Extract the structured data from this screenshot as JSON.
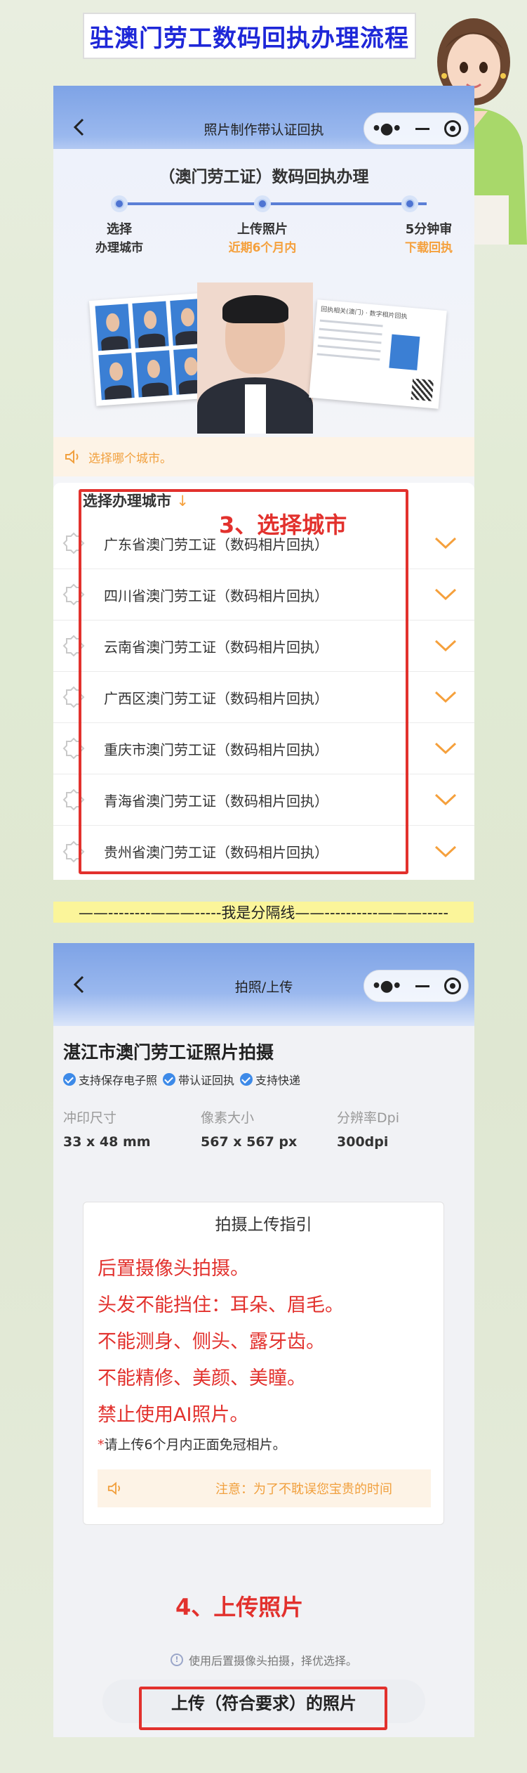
{
  "banner": {
    "title": "驻澳门劳工数码回执办理流程"
  },
  "phone1": {
    "nav_title": "照片制作带认证回执",
    "hero_title": "（澳门劳工证）数码回执办理",
    "steps": [
      {
        "label": "选择",
        "sub": "办理城市",
        "sub_color": "#333333"
      },
      {
        "label": "上传照片",
        "sub": "近期6个月内",
        "sub_color": "#f5a03c"
      },
      {
        "label": "5分钟审",
        "sub": "下载回执",
        "sub_color": "#f5a03c"
      }
    ],
    "receipt_header": "回执相关(澳门) · 数字相片回执",
    "notice": "选择哪个城市。",
    "city_header": "选择办理城市",
    "city_header_arrow": "↓",
    "cities": [
      "广东省澳门劳工证（数码相片回执）",
      "四川省澳门劳工证（数码相片回执）",
      "云南省澳门劳工证（数码相片回执）",
      "广西区澳门劳工证（数码相片回执）",
      "重庆市澳门劳工证（数码相片回执）",
      "青海省澳门劳工证（数码相片回执）",
      "贵州省澳门劳工证（数码相片回执）"
    ]
  },
  "annotations": {
    "step3": "3、选择城市",
    "step4": "4、上传照片"
  },
  "divider": {
    "text": "——--------———-----我是分隔线——----------———-----"
  },
  "phone2": {
    "nav_title": "拍照/上传",
    "title": "湛江市澳门劳工证照片拍摄",
    "tags": [
      "支持保存电子照",
      "带认证回执",
      "支持快递"
    ],
    "specs": [
      {
        "label": "冲印尺寸",
        "value": "33 x 48 mm"
      },
      {
        "label": "像素大小",
        "value": "567 x 567 px"
      },
      {
        "label": "分辨率Dpi",
        "value": "300dpi"
      }
    ],
    "guide_title": "拍摄上传指引",
    "guide_lines": [
      "后置摄像头拍摄。",
      "头发不能挡住：耳朵、眉毛。",
      "不能测身、侧头、露牙齿。",
      "不能精修、美颜、美瞳。",
      "禁止使用AI照片。"
    ],
    "guide_note_star": "*",
    "guide_note": "请上传6个月内正面免冠相片。",
    "guide_warning": "注意：为了不耽误您宝贵的时间",
    "hint": "使用后置摄像头拍摄，择优选择。",
    "upload_button": "上传（符合要求）的照片"
  },
  "colors": {
    "accent_blue": "#1e27d8",
    "annotation_red": "#e2312d",
    "orange": "#f5a03c",
    "divider_yellow": "#fbf59a"
  }
}
